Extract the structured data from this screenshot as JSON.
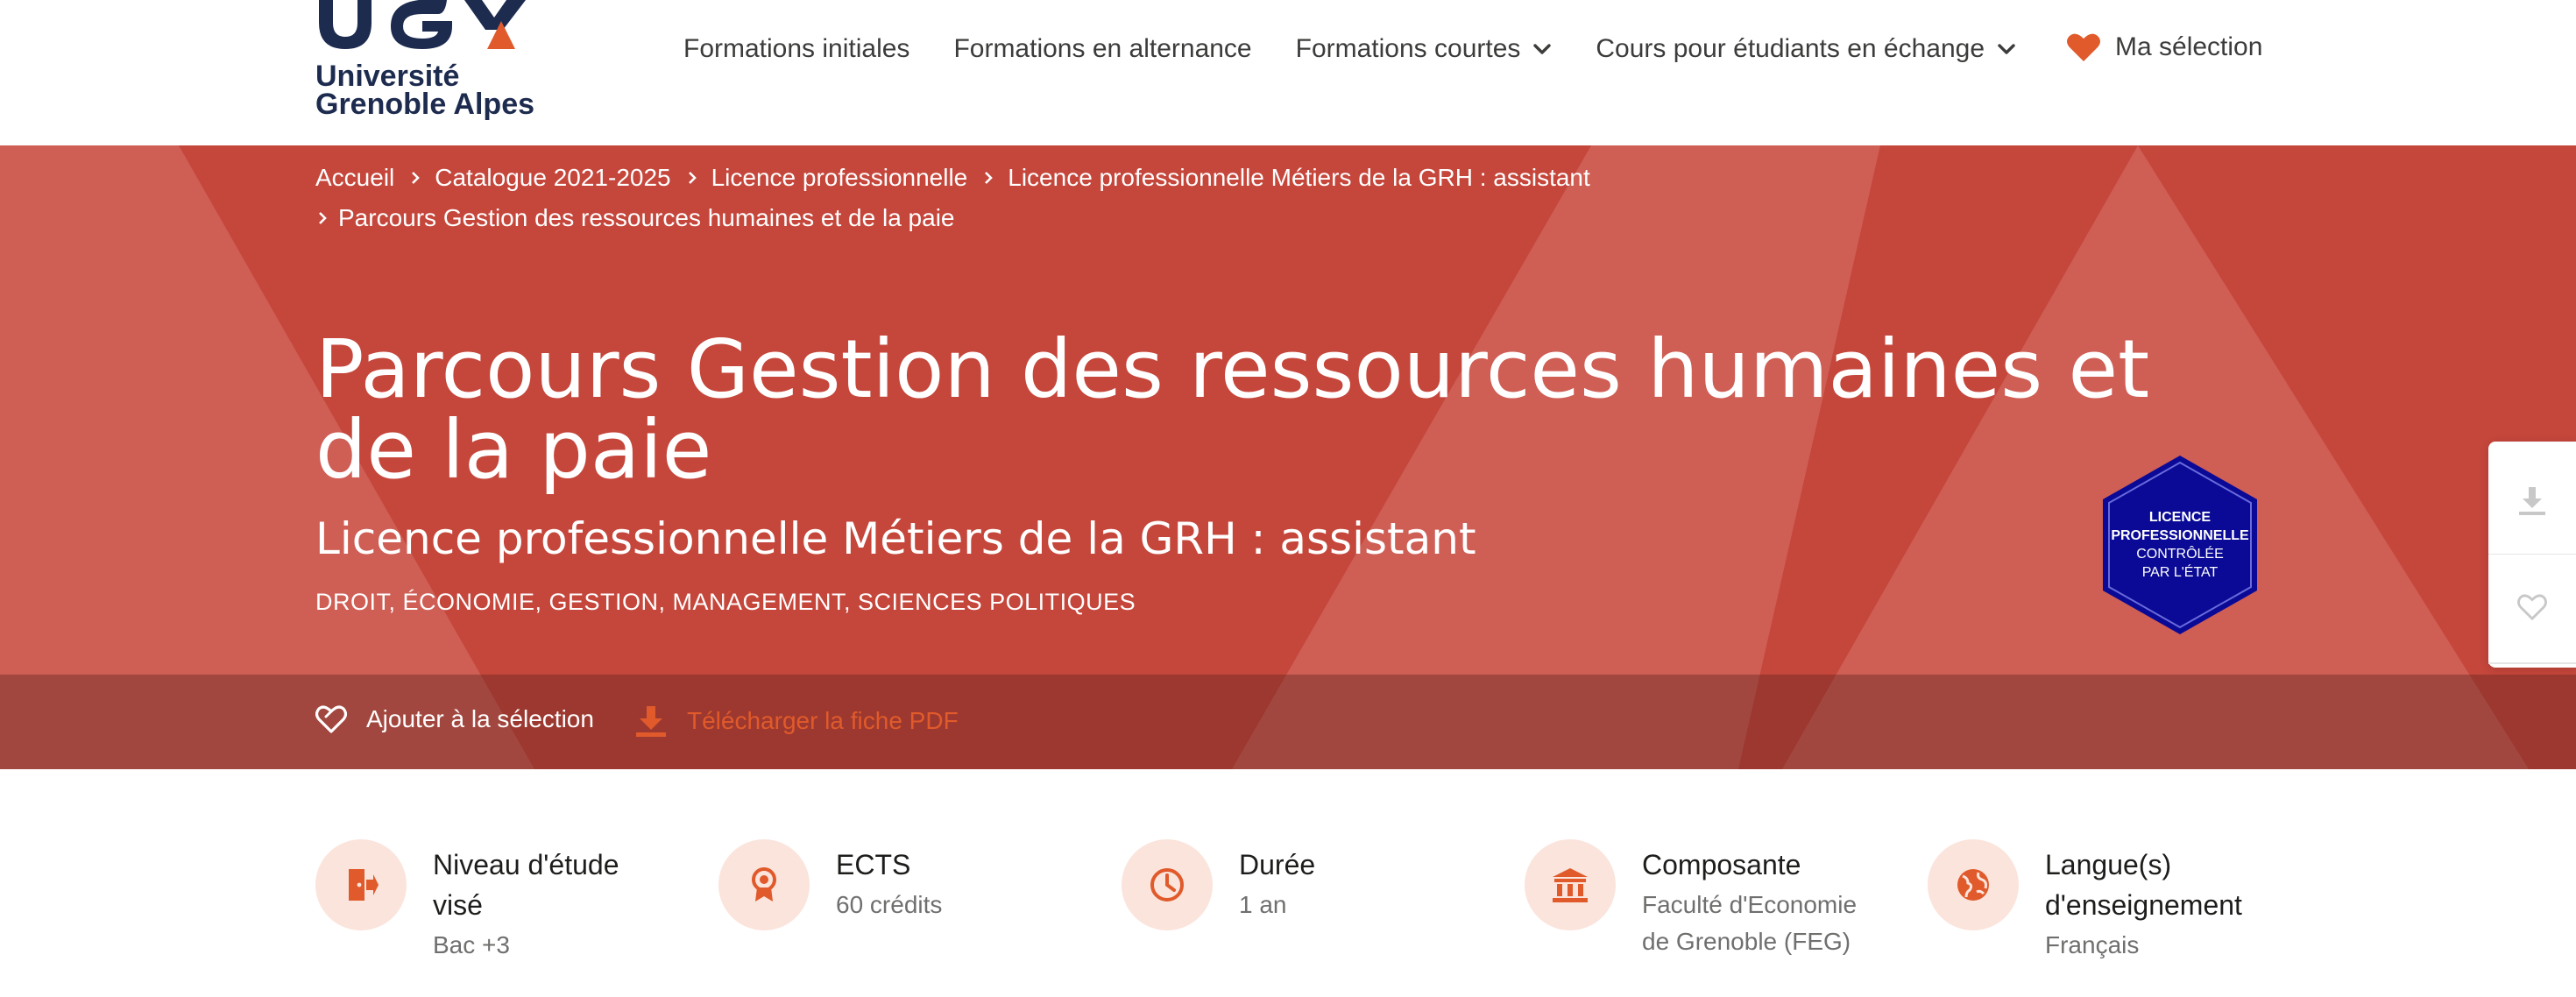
{
  "colors": {
    "accent": "#e05a2b",
    "hero_red": "#c5463b",
    "badge_blue": "#0a0a96",
    "icon_circle": "#fbe4dc"
  },
  "header": {
    "logo": {
      "line1": "Université",
      "line2": "Grenoble Alpes"
    },
    "nav": [
      {
        "label": "Formations initiales",
        "dropdown": false
      },
      {
        "label": "Formations en alternance",
        "dropdown": false
      },
      {
        "label": "Formations courtes",
        "dropdown": true
      },
      {
        "label": "Cours pour étudiants en échange",
        "dropdown": true
      }
    ],
    "selection_label": "Ma sélection",
    "selection_icon": "heart-filled-icon"
  },
  "breadcrumb": [
    "Accueil",
    "Catalogue 2021-2025",
    "Licence professionnelle",
    "Licence professionnelle Métiers de la GRH : assistant",
    "Parcours Gestion des ressources humaines et de la paie"
  ],
  "hero": {
    "title": "Parcours Gestion des ressources humaines et de la paie",
    "subtitle": "Licence professionnelle Métiers de la GRH : assistant",
    "domains": "DROIT, ÉCONOMIE, GESTION, MANAGEMENT, SCIENCES POLITIQUES",
    "badge": {
      "line1": "LICENCE",
      "line2": "PROFESSIONNELLE",
      "line3": "CONTRÔLÉE",
      "line4": "PAR L'ÉTAT"
    }
  },
  "actions": {
    "add_selection": "Ajouter à la sélection",
    "download_pdf": "Télécharger la fiche PDF"
  },
  "side_panel": {
    "download_icon": "download-icon",
    "favorite_icon": "heart-outline-icon"
  },
  "facts": [
    {
      "label": "Niveau d'étude visé",
      "value": "Bac +3",
      "icon": "door-exit-icon"
    },
    {
      "label": "ECTS",
      "value": "60 crédits",
      "icon": "award-ribbon-icon"
    },
    {
      "label": "Durée",
      "value": "1 an",
      "icon": "clock-icon"
    },
    {
      "label": "Composante",
      "value": "Faculté d'Economie de Grenoble (FEG)",
      "icon": "institution-icon"
    },
    {
      "label": "Langue(s) d'enseignement",
      "value": "Français",
      "icon": "globe-icon"
    }
  ]
}
